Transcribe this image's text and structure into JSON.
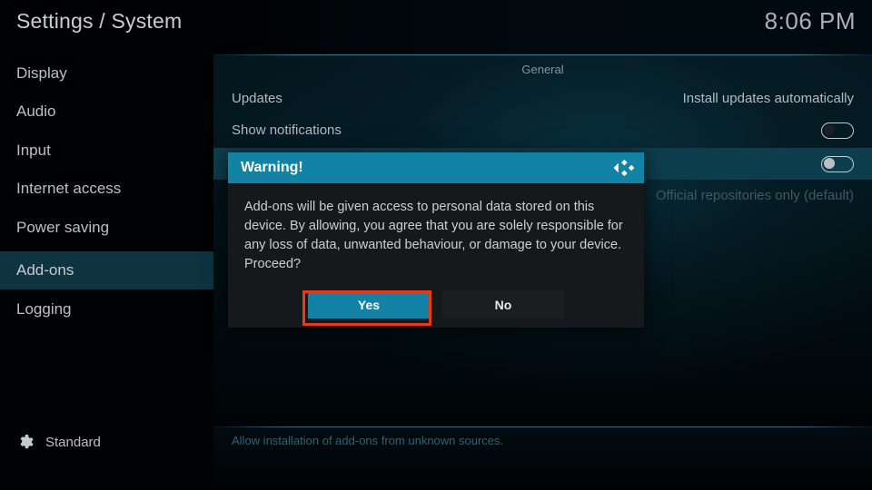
{
  "header": {
    "title": "Settings / System",
    "clock": "8:06 PM"
  },
  "sidebar": {
    "items": [
      {
        "label": "Display",
        "selected": false
      },
      {
        "label": "Audio",
        "selected": false
      },
      {
        "label": "Input",
        "selected": false
      },
      {
        "label": "Internet access",
        "selected": false
      },
      {
        "label": "Power saving",
        "selected": false
      },
      {
        "label": "Add-ons",
        "selected": true
      },
      {
        "label": "Logging",
        "selected": false
      }
    ],
    "footer": {
      "icon": "gear-icon",
      "label": "Standard"
    }
  },
  "content": {
    "group_title": "General",
    "rows": [
      {
        "label": "Updates",
        "value": "Install updates automatically",
        "control": "text",
        "highlighted": false,
        "dimmed": false
      },
      {
        "label": "Show notifications",
        "value": "",
        "control": "toggle",
        "toggle_on": false,
        "highlighted": false,
        "dimmed": false
      },
      {
        "label": "",
        "value": "",
        "control": "toggle",
        "toggle_on": false,
        "highlighted": true,
        "dimmed": false
      },
      {
        "label": "",
        "value": "Official repositories only (default)",
        "control": "text",
        "highlighted": false,
        "dimmed": true
      }
    ],
    "footer_description": "Allow installation of add-ons from unknown sources."
  },
  "dialog": {
    "title": "Warning!",
    "logo_icon": "kodi-logo-icon",
    "message": "Add-ons will be given access to personal data stored on this device. By allowing, you agree that you are solely responsible for any loss of data, unwanted behaviour, or damage to your device. Proceed?",
    "buttons": {
      "yes": "Yes",
      "no": "No"
    },
    "focused_button": "Yes"
  },
  "colors": {
    "accent_teal": "#1282a5",
    "sidebar_selected": "#0d3440",
    "row_highlight": "#0d3e4d",
    "annotation_red": "#e8391d",
    "dialog_bg": "#16191c",
    "text_primary": "#c8ced2",
    "text_dim": "#3e5a63"
  }
}
